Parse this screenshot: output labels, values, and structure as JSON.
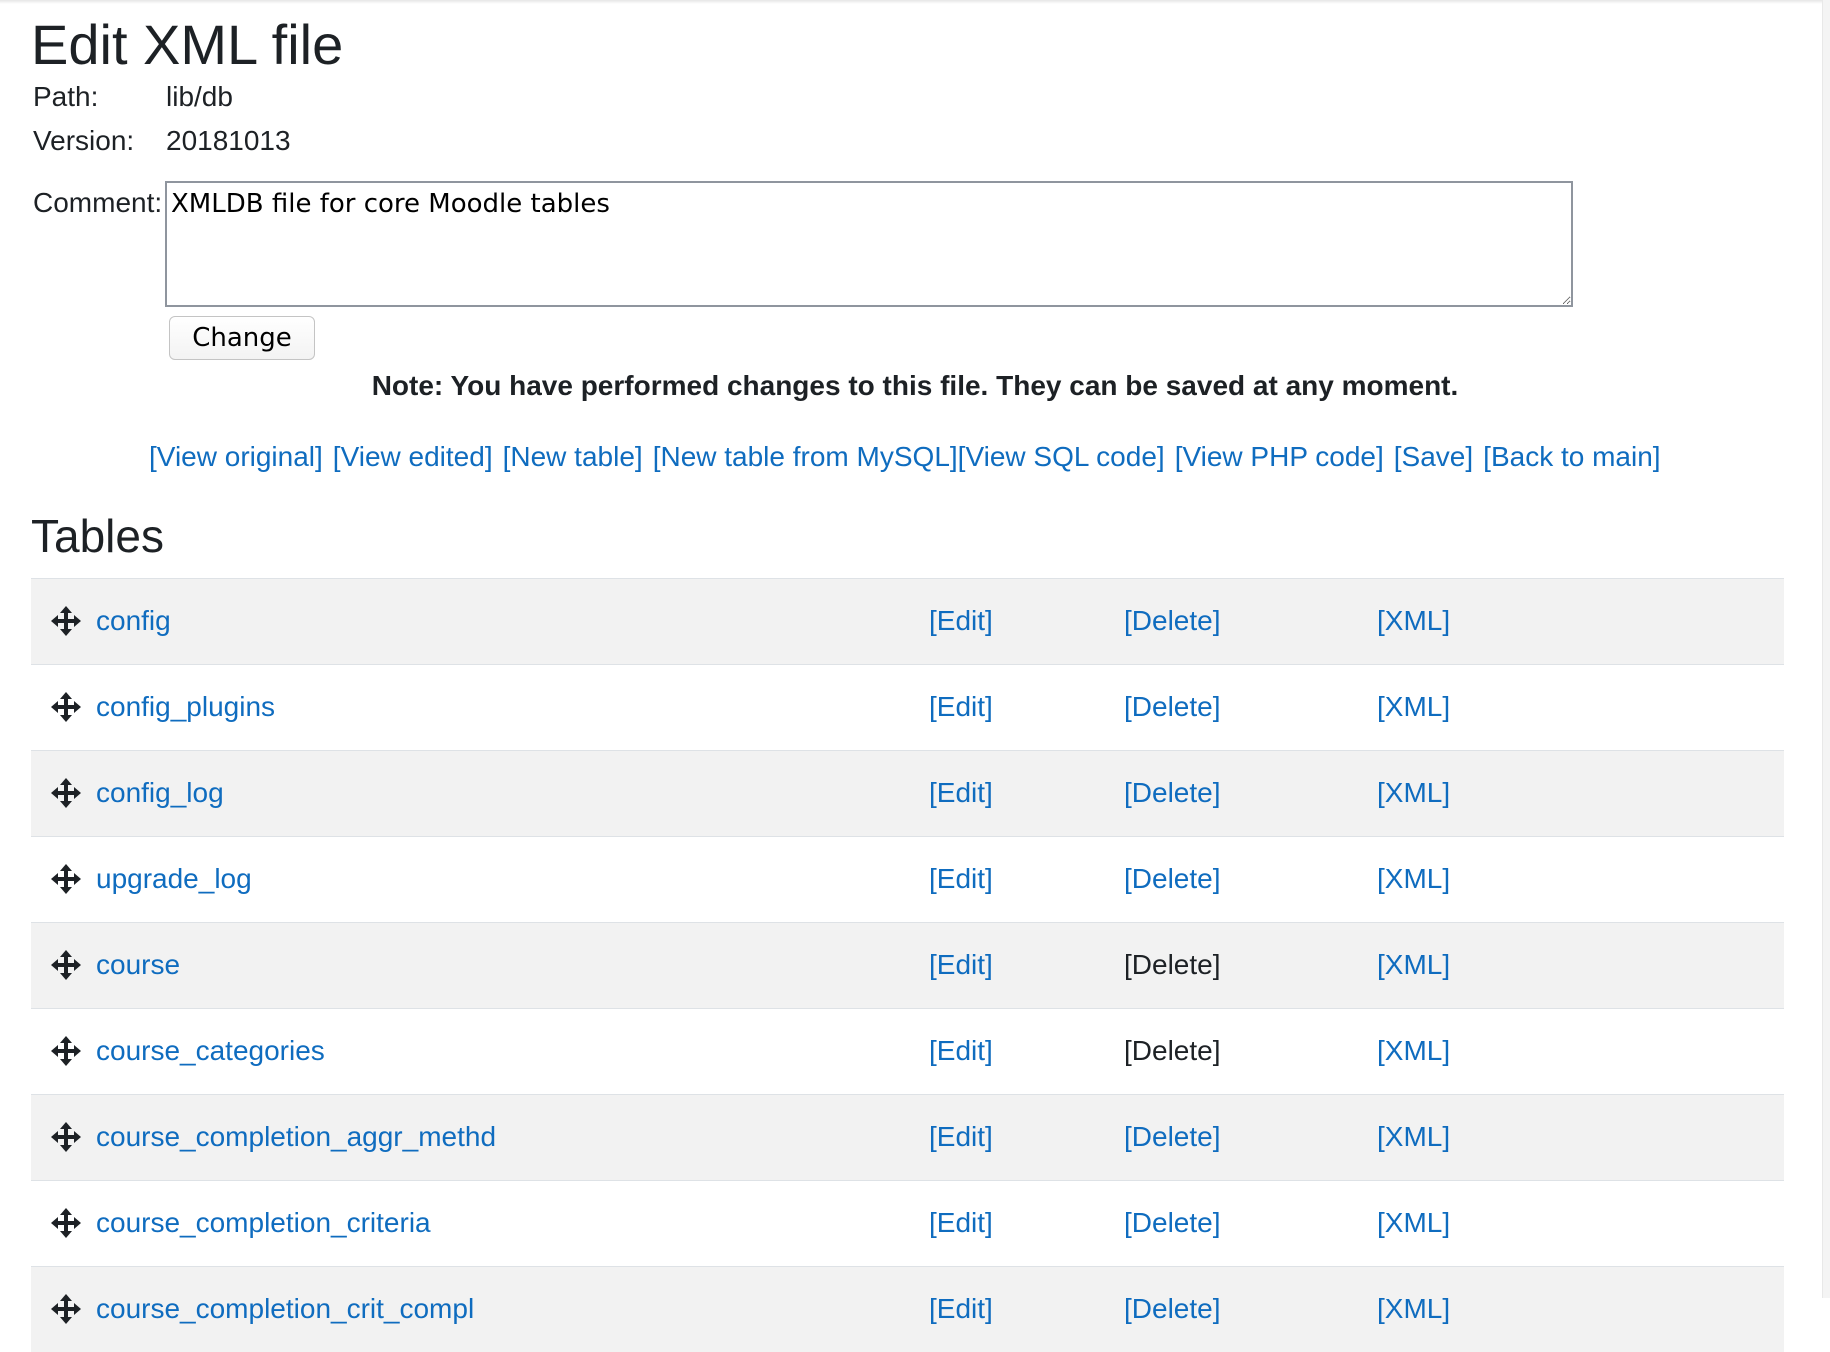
{
  "page": {
    "title": "Edit XML file",
    "section_title": "Tables"
  },
  "meta": {
    "path_label": "Path:",
    "path_value": "lib/db",
    "version_label": "Version:",
    "version_value": "20181013",
    "comment_label": "Comment:",
    "comment_value": "XMLDB file for core Moodle tables"
  },
  "form": {
    "change_label": "Change"
  },
  "note": "Note: You have performed changes to this file. They can be saved at any moment.",
  "actions": [
    "[View original]",
    "[View edited]",
    "[New table]",
    "[New table from MySQL]",
    "[View SQL code]",
    "[View PHP code]",
    "[Save]",
    "[Back to main]"
  ],
  "row_labels": {
    "edit": "[Edit]",
    "delete": "[Delete]",
    "xml": "[XML]"
  },
  "tables": [
    {
      "name": "config",
      "delete_enabled": true
    },
    {
      "name": "config_plugins",
      "delete_enabled": true
    },
    {
      "name": "config_log",
      "delete_enabled": true
    },
    {
      "name": "upgrade_log",
      "delete_enabled": true
    },
    {
      "name": "course",
      "delete_enabled": false
    },
    {
      "name": "course_categories",
      "delete_enabled": false
    },
    {
      "name": "course_completion_aggr_methd",
      "delete_enabled": true
    },
    {
      "name": "course_completion_criteria",
      "delete_enabled": true
    },
    {
      "name": "course_completion_crit_compl",
      "delete_enabled": true
    }
  ],
  "colors": {
    "link": "#0f6cbf",
    "text": "#1d2125",
    "row_alt": "#f2f2f2"
  },
  "icons": {
    "row_handle": "move-icon"
  }
}
